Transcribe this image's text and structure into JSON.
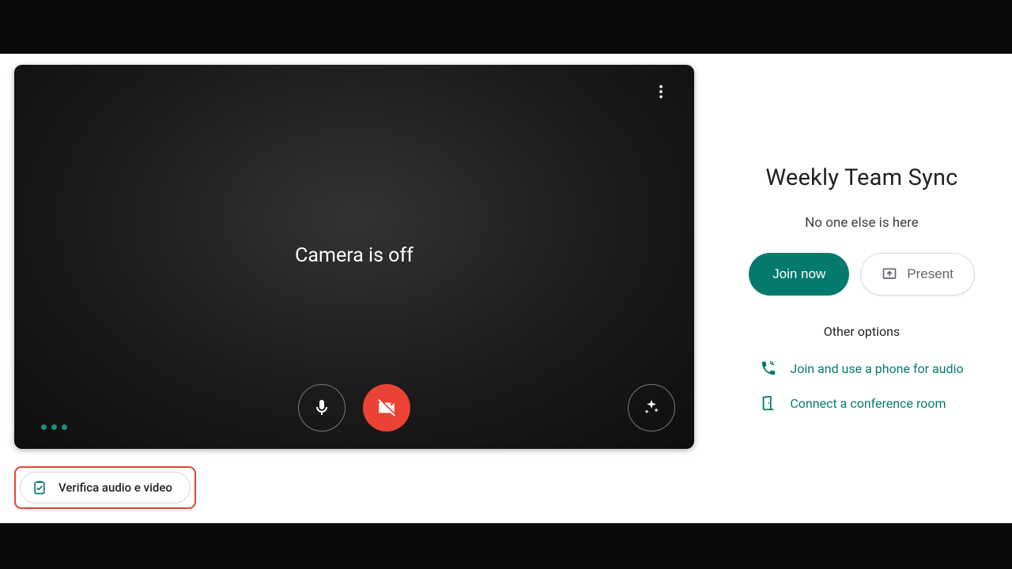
{
  "preview": {
    "camera_off_text": "Camera is off"
  },
  "check_pill": {
    "label": "Verifica audio e video"
  },
  "meeting": {
    "title": "Weekly Team Sync",
    "subtitle": "No one else is here",
    "join_label": "Join now",
    "present_label": "Present",
    "other_options_label": "Other options",
    "phone_link": "Join and use a phone for audio",
    "room_link": "Connect a conference room"
  }
}
